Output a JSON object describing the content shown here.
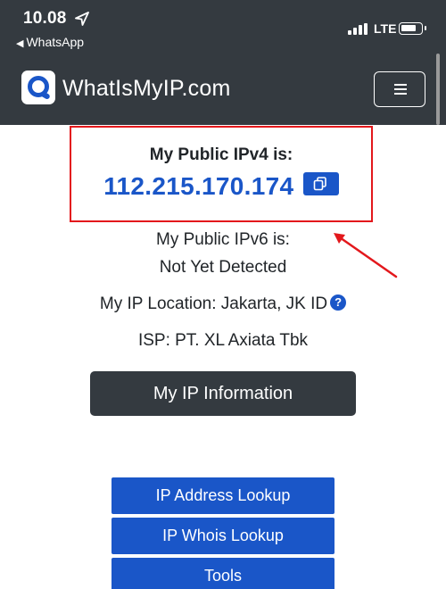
{
  "status_bar": {
    "time": "10.08",
    "back_app": "WhatsApp",
    "network": "LTE",
    "location_icon": "location-arrow-icon",
    "signal_icon": "cellular-signal-icon",
    "battery_icon": "battery-icon"
  },
  "navbar": {
    "brand": "WhatIsMyIP.com",
    "logo_icon": "whatismyip-logo-icon",
    "menu_icon": "hamburger-menu-icon"
  },
  "ip_info": {
    "ipv4_label": "My Public IPv4 is:",
    "ipv4_value": "112.215.170.174",
    "copy_icon": "copy-icon",
    "ipv6_label": "My Public IPv6 is:",
    "ipv6_value": "Not Yet Detected",
    "location_text": "My IP Location: Jakarta, JK ID",
    "help_icon": "question-circle-icon",
    "isp_text": "ISP: PT. XL Axiata Tbk"
  },
  "buttons": {
    "my_ip_information": "My IP Information",
    "ip_address_lookup": "IP Address Lookup",
    "ip_whois_lookup": "IP Whois Lookup",
    "tools": "Tools"
  },
  "colors": {
    "dark": "#343a40",
    "accent_blue": "#1a56c8",
    "annotation_red": "#e3181c"
  }
}
